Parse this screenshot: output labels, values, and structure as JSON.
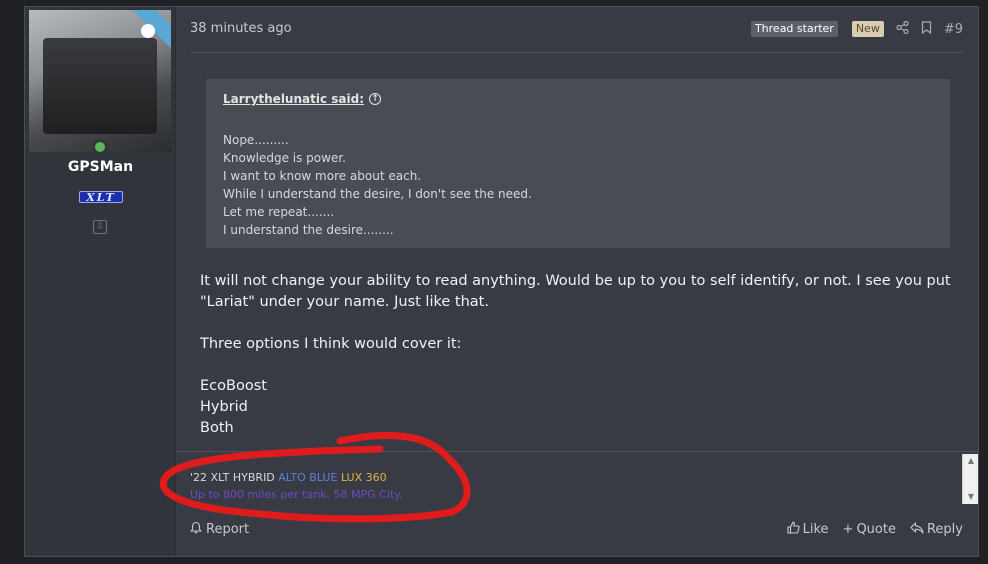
{
  "user": {
    "username": "GPSMan",
    "badge_text": "XLT"
  },
  "header": {
    "timestamp": "38 minutes ago",
    "thread_starter_label": "Thread starter",
    "new_label": "New",
    "post_number": "#9"
  },
  "quote": {
    "author": "Larrythelunatic said:",
    "lines": [
      "Nope.........",
      "Knowledge is power.",
      "I want to know more about each.",
      "While I understand the desire, I don't see the need.",
      "Let me repeat.......",
      "I understand the desire........"
    ]
  },
  "body": {
    "paragraph1": "It will not change your ability to read anything. Would be up to you to self identify, or not. I see you put \"Lariat\" under your name. Just like that.",
    "paragraph2": "Three options I think would cover it:",
    "options": [
      "EcoBoost",
      "Hybrid",
      "Both"
    ]
  },
  "signature": {
    "prefix": "'22 XLT HYBRID",
    "color_name": "ALTO BLUE",
    "package": "LUX 360",
    "line2": "Up to 800 miles per tank. 58 MPG City.",
    "colors": {
      "prefix": "#d8d8d8",
      "color_name": "#5a7fd6",
      "package": "#e0b14a",
      "line2": "#6a4bc2"
    }
  },
  "footer": {
    "report_label": "Report",
    "like_label": "Like",
    "quote_label": "Quote",
    "reply_label": "Reply"
  },
  "icons": {
    "share": "share-icon",
    "bookmark": "bookmark-icon",
    "report": "bell-icon",
    "like": "thumbs-up-icon",
    "quote": "plus-icon",
    "reply": "reply-icon"
  },
  "annotation_color": "#e01b1b"
}
